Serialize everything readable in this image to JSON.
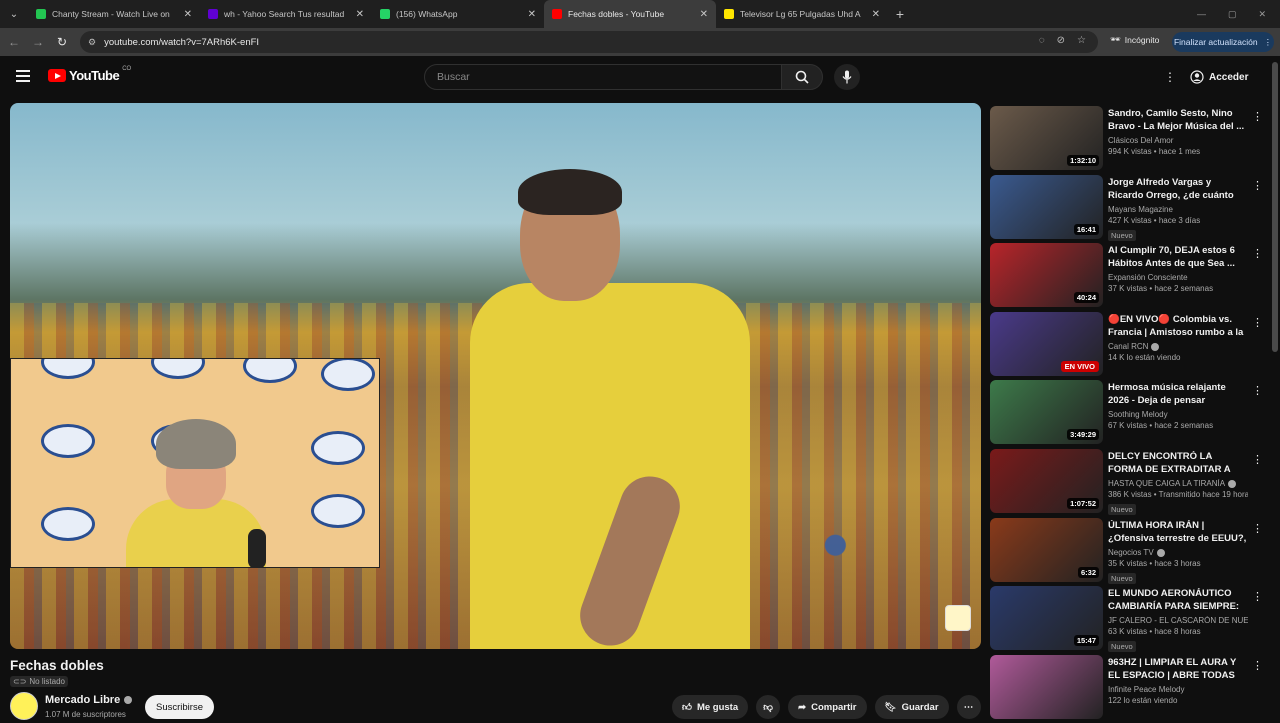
{
  "browser": {
    "tabs": [
      {
        "label": "Chanty Stream - Watch Live on",
        "color": "#23c552"
      },
      {
        "label": "wh - Yahoo Search Tus resultad",
        "color": "#6001d2"
      },
      {
        "label": "(156) WhatsApp",
        "color": "#25d366"
      },
      {
        "label": "Fechas dobles - YouTube",
        "color": "#ff0000"
      },
      {
        "label": "Televisor Lg 65 Pulgadas Uhd A",
        "color": "#ffe600"
      }
    ],
    "new_tab": "+",
    "url": "youtube.com/watch?v=7ARh6K-enFI",
    "incognito_label": "Incógnito",
    "update_label": "Finalizar actualización"
  },
  "header": {
    "logo_text": "YouTube",
    "logo_country": "CO",
    "search_placeholder": "Buscar",
    "signin_label": "Acceder"
  },
  "video": {
    "title": "Fechas dobles",
    "visibility": "No listado",
    "channel": "Mercado Libre",
    "subscribers": "1.07 M de suscriptores",
    "subscribe_label": "Suscribirse",
    "like_label": "Me gusta",
    "share_label": "Compartir",
    "save_label": "Guardar"
  },
  "recommendations": [
    {
      "title": "Sandro, Camilo Sesto, Nino Bravo - La Mejor Música del ...",
      "channel": "Clásicos Del Amor",
      "stats": "994 K vistas • hace 1 mes",
      "duration": "1:32:10",
      "new": false,
      "live": false,
      "verified": false,
      "color": "#6b5a4a"
    },
    {
      "title": "Jorge Alfredo Vargas y Ricardo Orrego, ¿de cuánto era su ...",
      "channel": "Mayans Magazine",
      "stats": "427 K vistas • hace 3 días",
      "duration": "16:41",
      "new": true,
      "live": false,
      "verified": false,
      "color": "#3a5a90"
    },
    {
      "title": "Al Cumplir 70, DEJA estos 6 Hábitos Antes de que Sea ...",
      "channel": "Expansión Consciente",
      "stats": "37 K vistas • hace 2 semanas",
      "duration": "40:24",
      "new": false,
      "live": false,
      "verified": false,
      "color": "#b8242a"
    },
    {
      "title": "🔴EN VIVO🔴 Colombia vs. Francia | Amistoso rumbo a la ...",
      "channel": "Canal RCN",
      "stats": "14 K lo están viendo",
      "duration": "EN VIVO",
      "new": false,
      "live": true,
      "verified": true,
      "color": "#4a3a8a"
    },
    {
      "title": "Hermosa música relajante 2026 - Deja de pensar demasiado, ...",
      "channel": "Soothing Melody",
      "stats": "67 K vistas • hace 2 semanas",
      "duration": "3:49:29",
      "new": false,
      "live": false,
      "verified": false,
      "color": "#3d7a4a"
    },
    {
      "title": "DELCY ENCONTRÓ LA FORMA DE EXTRADITAR A ALEX SAAB",
      "channel": "HASTA QUE CAIGA LA TIRANÍA",
      "stats": "386 K vistas • Transmitido hace 19 horas",
      "duration": "1:07:52",
      "new": true,
      "live": false,
      "verified": true,
      "color": "#7a1a1a"
    },
    {
      "title": "ÚLTIMA HORA IRÁN | ¿Ofensiva terrestre de EEUU?, Emiratos ...",
      "channel": "Negocios TV",
      "stats": "35 K vistas • hace 3 horas",
      "duration": "6:32",
      "new": true,
      "live": false,
      "verified": true,
      "color": "#8a3a1a"
    },
    {
      "title": "EL MUNDO AERONÁUTICO CAMBIARÍA PARA SIEMPRE: L...",
      "channel": "JF CALERO - EL CASCARÓN DE NUEZ",
      "stats": "63 K vistas • hace 8 horas",
      "duration": "15:47",
      "new": true,
      "live": false,
      "verified": false,
      "color": "#2a3a6a"
    },
    {
      "title": "963HZ | LIMPIAR EL AURA Y EL ESPACIO | ABRE TODAS LAS ...",
      "channel": "Infinite Peace Melody",
      "stats": "122 lo están viendo",
      "duration": "",
      "new": false,
      "live": false,
      "verified": false,
      "color": "#b05a9a"
    }
  ]
}
